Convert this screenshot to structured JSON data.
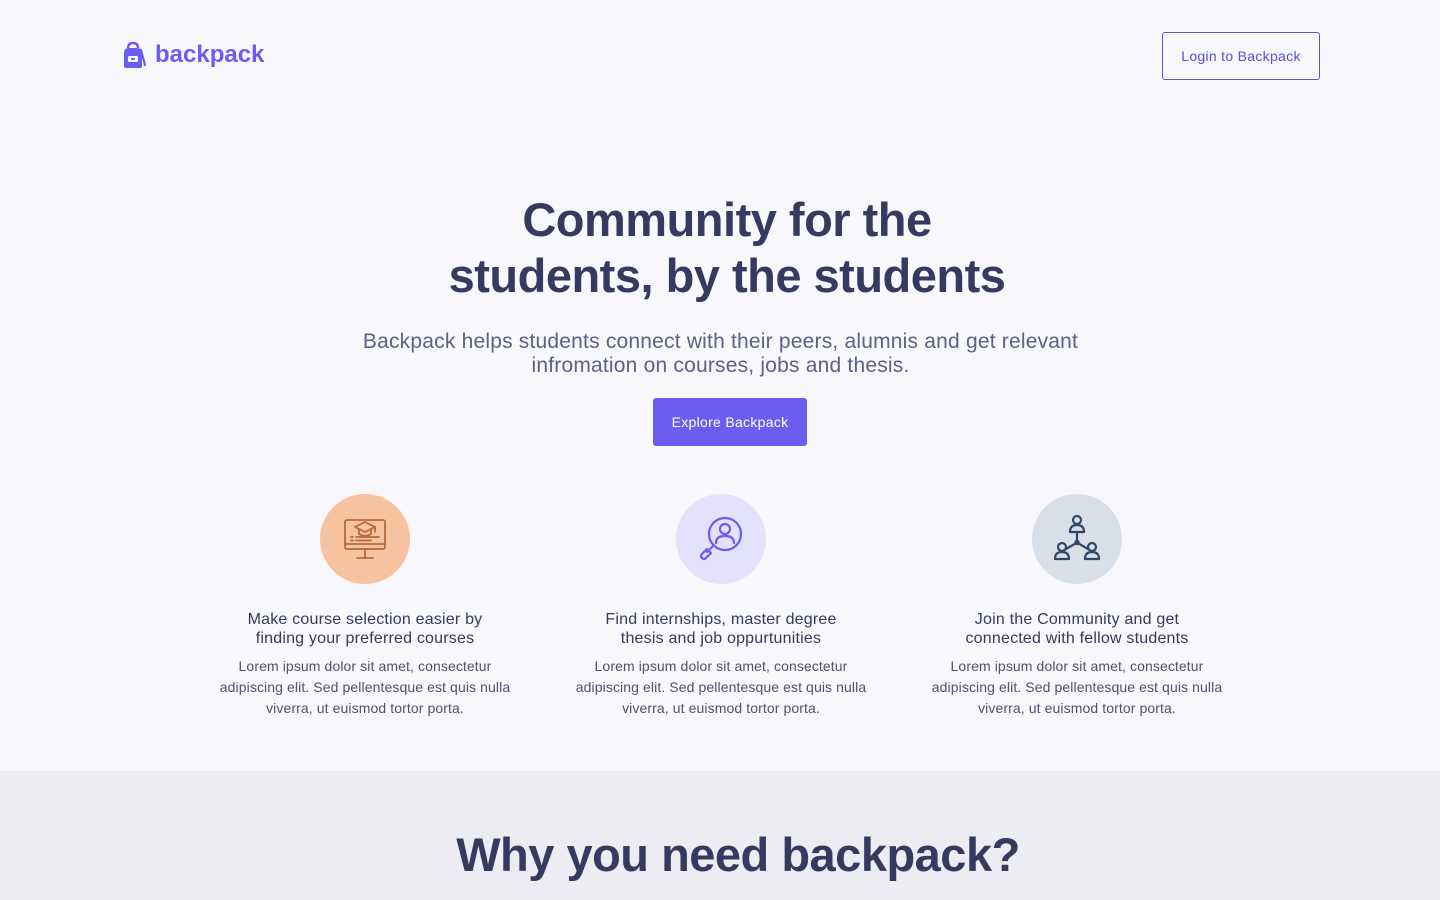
{
  "header": {
    "brand": "backpack",
    "brand_icon": "backpack-icon",
    "login_label": "Login to Backpack"
  },
  "hero": {
    "title_line1": "Community for the",
    "title_line2": "students, by the students",
    "subtitle": "Backpack helps students connect with their peers, alumnis and get relevant infromation on courses, jobs and thesis.",
    "cta_label": "Explore Backpack"
  },
  "features": [
    {
      "icon": "graduation-monitor-icon",
      "icon_bg": "#f7c2a0",
      "title": "Make course selection easier by finding your preferred courses",
      "text": "Lorem ipsum dolor sit amet, consectetur adipiscing elit. Sed pellentesque est quis nulla viverra, ut euismod tortor porta."
    },
    {
      "icon": "user-search-icon",
      "icon_bg": "#e3e1fb",
      "title": "Find internships, master degree thesis and job oppurtunities",
      "text": "Lorem ipsum dolor sit amet, consectetur adipiscing elit. Sed pellentesque est quis nulla viverra, ut euismod tortor porta."
    },
    {
      "icon": "community-network-icon",
      "icon_bg": "#d9dfe8",
      "title": "Join the Community and get connected with fellow students",
      "text": "Lorem ipsum dolor sit amet, consectetur adipiscing elit. Sed pellentesque est quis nulla viverra, ut euismod tortor porta."
    }
  ],
  "why": {
    "heading": "Why you need backpack?"
  },
  "colors": {
    "brand": "#6a5df0",
    "heading": "#363a61",
    "page_bg": "#f7f7fc",
    "section_bg": "#edecf3"
  }
}
